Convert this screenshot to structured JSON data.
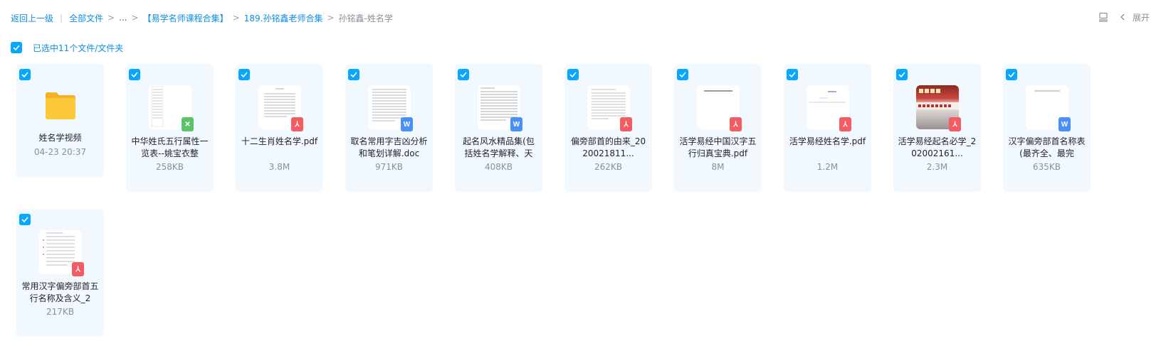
{
  "breadcrumb": {
    "back": "返回上一级",
    "all_files": "全部文件",
    "ellipsis": "...",
    "level1": "【易学名师课程合集】",
    "level2": "189.孙铭鑫老师合集",
    "current": "孙铭鑫-姓名学"
  },
  "toolbar": {
    "expand_label": "展开",
    "layout_icon": "layout-icon",
    "chevron_icon": "chevron-left-icon"
  },
  "selection": {
    "label": "已选中11个文件/文件夹"
  },
  "files": [
    {
      "name": "姓名学视频",
      "meta": "04-23 20:37",
      "type": "folder"
    },
    {
      "name": "中华姓氏五行属性一览表--姚宝衣整",
      "meta": "258KB",
      "type": "xls"
    },
    {
      "name": "十二生肖姓名学.pdf",
      "meta": "3.8M",
      "type": "pdf"
    },
    {
      "name": "取名常用字吉凶分析和笔划详解.doc",
      "meta": "971KB",
      "type": "doc"
    },
    {
      "name": "起名风水精品集(包括姓名学解释、天",
      "meta": "408KB",
      "type": "doc"
    },
    {
      "name": "偏旁部首的由来_2020021811...",
      "meta": "262KB",
      "type": "pdf"
    },
    {
      "name": "活学易经中国汉字五行归真宝典.pdf",
      "meta": "8M",
      "type": "pdf"
    },
    {
      "name": "活学易经姓名学.pdf",
      "meta": "1.2M",
      "type": "pdf"
    },
    {
      "name": "活学易经起名必学_202002161...",
      "meta": "2.3M",
      "type": "pdf"
    },
    {
      "name": "汉字偏旁部首名称表(最齐全、最完",
      "meta": "635KB",
      "type": "doc"
    },
    {
      "name": "常用汉字偏旁部首五行名称及含义_2",
      "meta": "217KB",
      "type": "pdf"
    }
  ],
  "colors": {
    "accent": "#06a7ff",
    "link": "#0d8ee3",
    "card_bg": "#f1f8fe",
    "pdf_badge": "#f25c62",
    "doc_badge": "#4a8ef8",
    "xls_badge": "#5cc36a",
    "folder": "#fcc93b"
  }
}
